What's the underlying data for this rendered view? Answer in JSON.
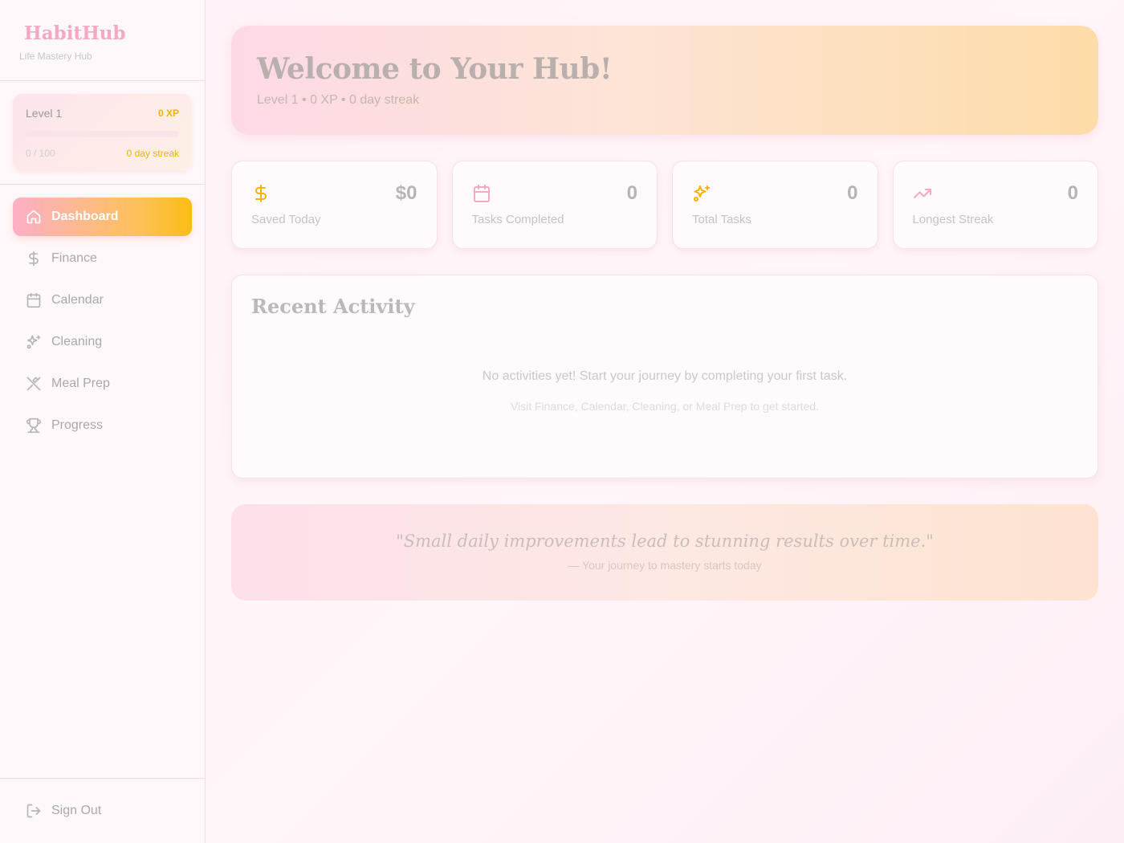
{
  "sidebar": {
    "brand": {
      "glyph": "",
      "title": "HabitHub",
      "subtitle": "Life Mastery Hub"
    },
    "level": {
      "label": "Level 1",
      "xp": "0 XP",
      "progress_text": "0 / 100",
      "progress_fraction": 0,
      "streak": " 0 day streak"
    },
    "nav": [
      {
        "label": "Dashboard",
        "icon": "home-icon",
        "active": true
      },
      {
        "label": "Finance",
        "icon": "dollar-icon"
      },
      {
        "label": "Calendar",
        "icon": "calendar-icon"
      },
      {
        "label": "Cleaning",
        "icon": "sparkles-icon"
      },
      {
        "label": "Meal Prep",
        "icon": "utensils-icon"
      },
      {
        "label": "Progress",
        "icon": "trophy-icon"
      }
    ],
    "signout": {
      "label": "Sign Out",
      "icon": "logout-icon"
    }
  },
  "hero": {
    "title": "Welcome to Your Hub! ",
    "subtitle": "Level 1 • 0 XP • 0 day streak "
  },
  "stats": [
    {
      "value": "$0",
      "label": "Saved Today",
      "icon": "dollar-icon",
      "color": "#f6b400"
    },
    {
      "value": "0",
      "label": "Tasks Completed",
      "icon": "calendar-icon",
      "color": "#f5a8c4"
    },
    {
      "value": "0",
      "label": "Total Tasks",
      "icon": "sparkles-icon",
      "color": "#f6b400"
    },
    {
      "value": "0",
      "label": "Longest Streak",
      "icon": "trending-up-icon",
      "color": "#f5a8c4"
    }
  ],
  "activity": {
    "title": "Recent Activity",
    "empty_primary": "No activities yet! Start your journey by completing your first task.",
    "empty_secondary": "Visit Finance, Calendar, Cleaning, or Meal Prep to get started."
  },
  "quote": {
    "text": "\"Small daily improvements lead to stunning results over time.\"",
    "attribution": "— Your journey to mastery starts today"
  },
  "colors": {
    "accent_pink": "#f5a8c4",
    "accent_gold": "#f6b400"
  }
}
